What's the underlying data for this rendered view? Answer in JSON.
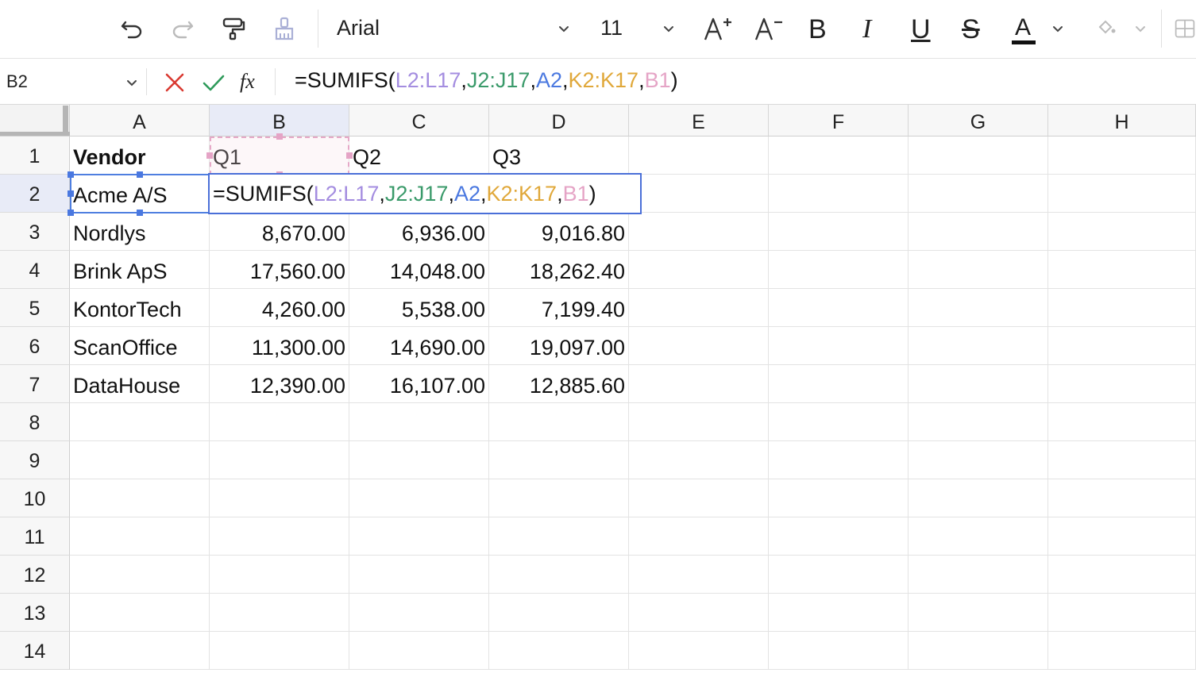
{
  "toolbar": {
    "font_name": "Arial",
    "font_size": "11",
    "bold_label": "B",
    "italic_label": "I",
    "underline_label": "U",
    "strike_label": "S",
    "font_color_label": "A",
    "icons": [
      "undo-icon",
      "redo-icon",
      "paint-format-icon",
      "clear-format-icon",
      "chevron-down-icon",
      "increase-font-icon",
      "decrease-font-icon",
      "fill-color-icon",
      "borders-icon"
    ]
  },
  "formula_bar": {
    "name_box": "B2",
    "fx_label": "fx",
    "formula_parts": [
      {
        "text": "=SUMIFS(",
        "color": "default"
      },
      {
        "text": "L2:L17",
        "color": "purple"
      },
      {
        "text": ",",
        "color": "default"
      },
      {
        "text": "J2:J17",
        "color": "green"
      },
      {
        "text": ",",
        "color": "default"
      },
      {
        "text": "A2",
        "color": "blue"
      },
      {
        "text": ",",
        "color": "default"
      },
      {
        "text": "K2:K17",
        "color": "gold"
      },
      {
        "text": ",",
        "color": "default"
      },
      {
        "text": "B1",
        "color": "pink"
      },
      {
        "text": ")",
        "color": "default"
      }
    ]
  },
  "colors": {
    "purple": "#a48de0",
    "green": "#3a9a6a",
    "blue": "#4a78e0",
    "gold": "#e0a83a",
    "pink": "#e5a4c6",
    "selection": "#4a6fd8",
    "cancel": "#d93a32",
    "confirm": "#2e9a5a"
  },
  "grid": {
    "columns": [
      "A",
      "B",
      "C",
      "D",
      "E",
      "F",
      "G",
      "H"
    ],
    "rows": [
      "1",
      "2",
      "3",
      "4",
      "5",
      "6",
      "7",
      "8",
      "9",
      "10",
      "11",
      "12",
      "13",
      "14"
    ],
    "active_cell": "B2",
    "cells": {
      "A1": "Vendor",
      "B1": "Q1",
      "C1": "Q2",
      "D1": "Q3",
      "A2": "Acme A/S",
      "A3": "Nordlys",
      "B3": "8,670.00",
      "C3": "6,936.00",
      "D3": "9,016.80",
      "A4": "Brink ApS",
      "B4": "17,560.00",
      "C4": "14,048.00",
      "D4": "18,262.40",
      "A5": "KontorTech",
      "B5": "4,260.00",
      "C5": "5,538.00",
      "D5": "7,199.40",
      "A6": "ScanOffice",
      "B6": "11,300.00",
      "C6": "14,690.00",
      "D6": "19,097.00",
      "A7": "DataHouse",
      "B7": "12,390.00",
      "C7": "16,107.00",
      "D7": "12,885.60"
    }
  }
}
